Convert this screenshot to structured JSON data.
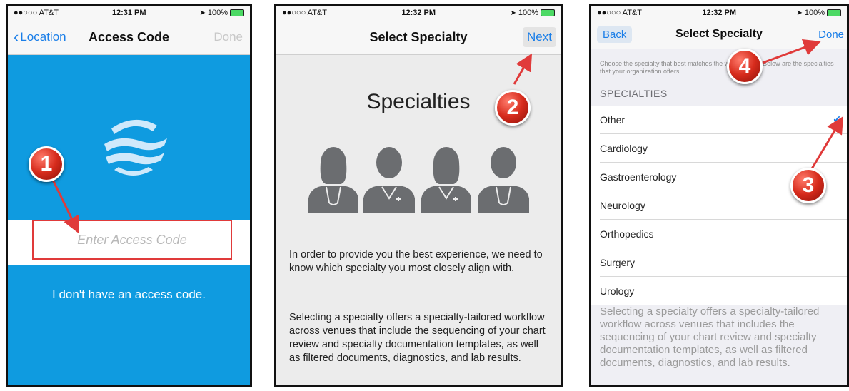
{
  "phone1": {
    "status": {
      "carrier": "●●○○○ AT&T",
      "time": "12:31 PM",
      "battery": "100%"
    },
    "nav": {
      "back_label": "Location",
      "title": "Access Code",
      "done_label": "Done"
    },
    "access_code_placeholder": "Enter Access Code",
    "no_code_link": "I don't have an access code.",
    "marker": "1"
  },
  "phone2": {
    "status": {
      "carrier": "●●○○○ AT&T",
      "time": "12:32 PM",
      "battery": "100%"
    },
    "nav": {
      "title": "Select Specialty",
      "next_label": "Next"
    },
    "heading": "Specialties",
    "paragraph1": "In order to provide you the best experience, we need to know which specialty you most closely align with.",
    "paragraph2": "Selecting a specialty offers a specialty-tailored workflow across venues that include the sequencing of your chart review and specialty documentation templates, as well as filtered documents, diagnostics, and lab results.",
    "marker": "2"
  },
  "phone3": {
    "status": {
      "carrier": "●●○○○ AT&T",
      "time": "12:32 PM",
      "battery": "100%"
    },
    "nav": {
      "back_label": "Back",
      "title": "Select Specialty",
      "done_label": "Done"
    },
    "description": "Choose the specialty that best matches the work you do. Below are the specialties that your organization offers.",
    "section_header": "SPECIALTIES",
    "specialties": [
      {
        "label": "Other",
        "selected": true
      },
      {
        "label": "Cardiology",
        "selected": false
      },
      {
        "label": "Gastroenterology",
        "selected": false
      },
      {
        "label": "Neurology",
        "selected": false
      },
      {
        "label": "Orthopedics",
        "selected": false
      },
      {
        "label": "Surgery",
        "selected": false
      },
      {
        "label": "Urology",
        "selected": false
      }
    ],
    "footer": "Selecting a specialty offers a specialty-tailored workflow across venues that includes the sequencing of your chart review and specialty documentation templates, as well as filtered documents, diagnostics, and lab results.",
    "marker3": "3",
    "marker4": "4"
  },
  "colors": {
    "brand_blue": "#0f9be0",
    "ios_blue": "#1a7ee8",
    "annotation_red": "#d62b1c"
  }
}
